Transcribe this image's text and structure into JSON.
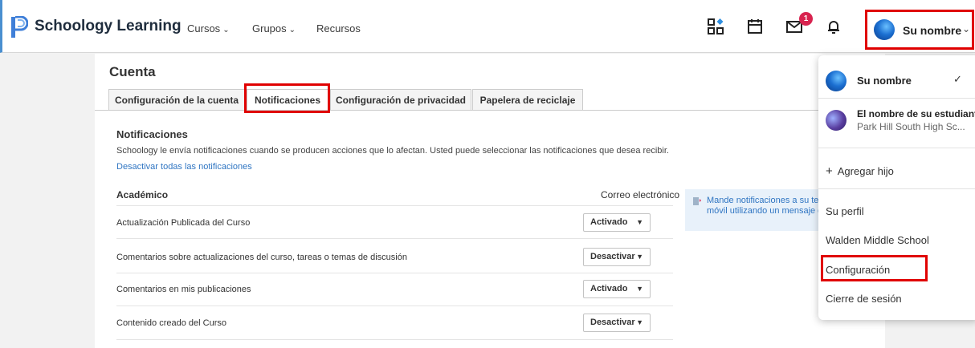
{
  "app": {
    "brand": "Schoology Learning"
  },
  "nav": [
    {
      "label": "Cursos",
      "has_menu": true
    },
    {
      "label": "Grupos",
      "has_menu": true
    },
    {
      "label": "Recursos",
      "has_menu": false
    }
  ],
  "toolbar": {
    "icons": [
      "apps-grid-icon",
      "calendar-icon",
      "messages-icon",
      "bell-icon"
    ],
    "messages_badge": "1",
    "user_name": "Su nombre"
  },
  "page": {
    "title": "Cuenta",
    "tabs": [
      {
        "label": "Configuración de la cuenta",
        "active": false
      },
      {
        "label": "Notificaciones",
        "active": true
      },
      {
        "label": "Configuración de privacidad",
        "active": false
      },
      {
        "label": "Papelera de reciclaje",
        "active": false
      }
    ]
  },
  "notifications": {
    "title": "Notificaciones",
    "description": "Schoology le envía notificaciones cuando se producen acciones que lo afectan. Usted puede seleccionar las notificaciones que desea recibir.",
    "disable_all_link": "Desactivar todas las notificaciones",
    "table": {
      "category": "Académico",
      "email_column": "Correo electrónico",
      "rows": [
        {
          "label": "Actualización Publicada del Curso",
          "value": "Activado"
        },
        {
          "label": "Comentarios sobre actualizaciones del curso, tareas o temas de discusión",
          "value": "Desactivar"
        },
        {
          "label": "Comentarios en mis publicaciones",
          "value": "Activado"
        },
        {
          "label": "Contenido creado del Curso",
          "value": "Desactivar"
        }
      ]
    },
    "sms_promo": {
      "line1": "Mande notificaciones a su te",
      "line2": "móvil utilizando un mensaje d"
    }
  },
  "user_menu": {
    "current_user": "Su nombre",
    "student_name": "El nombre de su estudiante",
    "student_school": "Park Hill South High Sc...",
    "add_child": "Agregar hijo",
    "profile": "Su perfil",
    "school": "Walden Middle School",
    "settings": "Configuración",
    "logout": "Cierre de sesión"
  },
  "colors": {
    "highlight": "#e00000",
    "link": "#2f75c2",
    "badge": "#d8234f"
  }
}
